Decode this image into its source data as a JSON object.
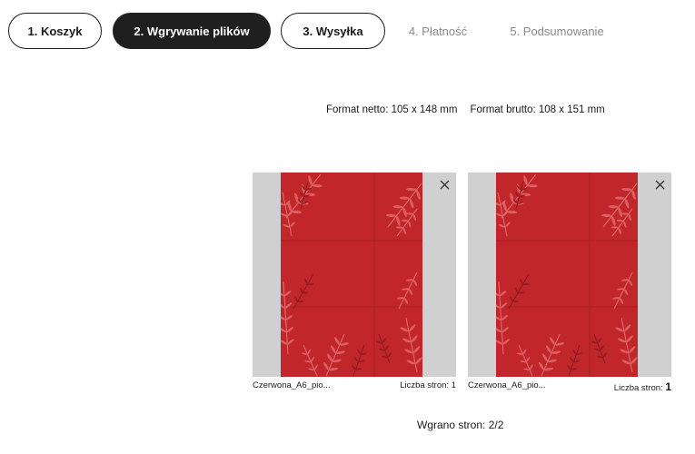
{
  "steps": [
    {
      "label": "1. Koszyk",
      "state": "outline"
    },
    {
      "label": "2. Wgrywanie plików",
      "state": "active"
    },
    {
      "label": "3. Wysyłka",
      "state": "outline"
    },
    {
      "label": "4. Płatność",
      "state": "plain"
    },
    {
      "label": "5. Podsumowanie",
      "state": "plain"
    }
  ],
  "format": {
    "net": "Format netto: 105 x 148 mm",
    "gross": "Format brutto: 108 x 151 mm"
  },
  "files": [
    {
      "name": "Czerwona_A6_pio...",
      "pages_label": "Liczba stron:",
      "pages": "1",
      "close_icon": "close-icon"
    },
    {
      "name": "Czerwona_A6_pio...",
      "pages_label": "Liczba stron:",
      "pages": "1",
      "close_icon": "close-icon"
    }
  ],
  "uploaded": "Wgrano stron: 2/2",
  "colors": {
    "design_red": "#c0262a",
    "bleed_gray": "#d0d0d0",
    "active_step": "#1f1f1f",
    "inactive_step_text": "#8a8a8a"
  }
}
